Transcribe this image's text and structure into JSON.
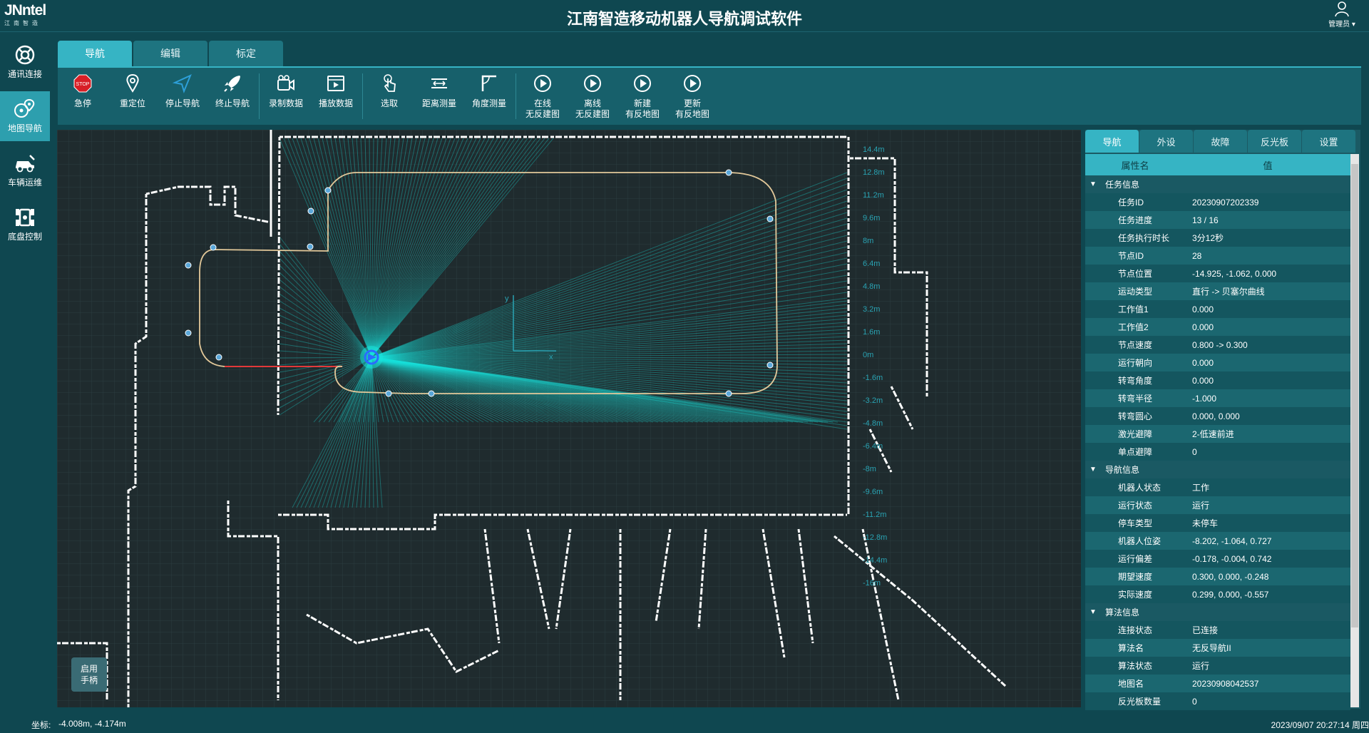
{
  "app": {
    "logo": "JNntel",
    "logo_sub": "江南智造",
    "title": "江南智造移动机器人导航调试软件",
    "user": "管理员"
  },
  "left_nav": [
    {
      "label": "通讯连接",
      "icon": "lifebuoy-icon"
    },
    {
      "label": "地图导航",
      "icon": "map-pin-icon",
      "active": true
    },
    {
      "label": "车辆运维",
      "icon": "vehicle-maintenance-icon"
    },
    {
      "label": "底盘控制",
      "icon": "chassis-control-icon"
    }
  ],
  "main_tabs": [
    {
      "label": "导航",
      "active": true
    },
    {
      "label": "编辑"
    },
    {
      "label": "标定"
    }
  ],
  "toolbar": {
    "estop": "急停",
    "estop_badge": "STOP",
    "relocate": "重定位",
    "stop_nav": "停止导航",
    "end_nav": "终止导航",
    "record": "录制数据",
    "play": "播放数据",
    "select": "选取",
    "distance": "距离测量",
    "angle": "角度测量",
    "online_map_1": "在线",
    "online_map_2": "无反建图",
    "offline_map_1": "离线",
    "offline_map_2": "无反建图",
    "new_map_1": "新建",
    "new_map_2": "有反地图",
    "update_map_1": "更新",
    "update_map_2": "有反地图"
  },
  "map": {
    "y_ticks": [
      "14.4m",
      "12.8m",
      "11.2m",
      "9.6m",
      "8m",
      "6.4m",
      "4.8m",
      "3.2m",
      "1.6m",
      "0m",
      "-1.6m",
      "-3.2m",
      "-4.8m",
      "-6.4m",
      "-8m",
      "-9.6m",
      "-11.2m",
      "-12.8m",
      "-14.4m",
      "-16m"
    ],
    "axis_x": "x",
    "axis_y": "y",
    "joystick_1": "启用",
    "joystick_2": "手柄",
    "colors": {
      "background": "#1f2b2e",
      "grid": "#2b3d40",
      "laser": "#19e3dc",
      "path": "#e3c99a",
      "walls": "#ffffff"
    }
  },
  "right_panel": {
    "tabs": [
      {
        "label": "导航",
        "active": true
      },
      {
        "label": "外设"
      },
      {
        "label": "故障"
      },
      {
        "label": "反光板"
      },
      {
        "label": "设置"
      }
    ],
    "col_name": "属性名",
    "col_value": "值",
    "groups": [
      {
        "title": "任务信息",
        "rows": [
          {
            "k": "任务ID",
            "v": "20230907202339"
          },
          {
            "k": "任务进度",
            "v": "13 / 16"
          },
          {
            "k": "任务执行时长",
            "v": "3分12秒"
          },
          {
            "k": "节点ID",
            "v": "28"
          },
          {
            "k": "节点位置",
            "v": "-14.925, -1.062, 0.000"
          },
          {
            "k": "运动类型",
            "v": "直行 -> 贝塞尔曲线"
          },
          {
            "k": "工作值1",
            "v": "0.000"
          },
          {
            "k": "工作值2",
            "v": "0.000"
          },
          {
            "k": "节点速度",
            "v": "0.800 -> 0.300"
          },
          {
            "k": "运行朝向",
            "v": "0.000"
          },
          {
            "k": "转弯角度",
            "v": "0.000"
          },
          {
            "k": "转弯半径",
            "v": "-1.000"
          },
          {
            "k": "转弯圆心",
            "v": "0.000, 0.000"
          },
          {
            "k": "激光避障",
            "v": "2-低速前进"
          },
          {
            "k": "单点避障",
            "v": "0"
          }
        ]
      },
      {
        "title": "导航信息",
        "rows": [
          {
            "k": "机器人状态",
            "v": "工作"
          },
          {
            "k": "运行状态",
            "v": "运行"
          },
          {
            "k": "停车类型",
            "v": "未停车"
          },
          {
            "k": "机器人位姿",
            "v": "-8.202, -1.064, 0.727"
          },
          {
            "k": "运行偏差",
            "v": "-0.178, -0.004, 0.742"
          },
          {
            "k": "期望速度",
            "v": "0.300, 0.000, -0.248"
          },
          {
            "k": "实际速度",
            "v": "0.299, 0.000, -0.557"
          }
        ]
      },
      {
        "title": "算法信息",
        "rows": [
          {
            "k": "连接状态",
            "v": "已连接"
          },
          {
            "k": "算法名",
            "v": "无反导航II"
          },
          {
            "k": "算法状态",
            "v": "运行"
          },
          {
            "k": "地图名",
            "v": "20230908042537"
          },
          {
            "k": "反光板数量",
            "v": "0"
          }
        ]
      }
    ]
  },
  "status": {
    "coord_label": "坐标:",
    "coord_value": "-4.008m, -4.174m",
    "datetime": "2023/09/07 20:27:14 周四"
  }
}
